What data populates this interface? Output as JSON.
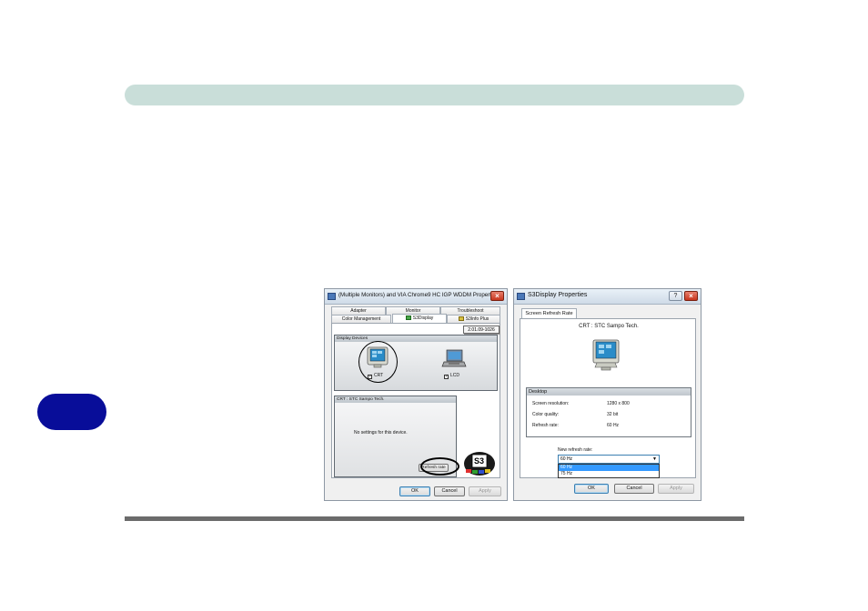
{
  "dialog_left": {
    "title": "(Multiple Monitors) and VIA Chrome9 HC IGP WDDM  Properties",
    "close_symbol": "×",
    "tabs_row1": [
      "Adapter",
      "Monitor",
      "Troubleshoot"
    ],
    "tabs_row2": [
      "Color Management",
      "S3Display",
      "S3Info Plus"
    ],
    "version": "2.01.09-1026",
    "display_devices_label": "Display Devices",
    "crt_label": "CRT",
    "lcd_label": "LCD",
    "device_group_label": "CRT : STC Sampo Tech.",
    "no_settings_text": "No settings for this device.",
    "refresh_rate_button": "Refresh rate",
    "logo_text": "S3",
    "buttons": {
      "ok": "OK",
      "cancel": "Cancel",
      "apply": "Apply"
    }
  },
  "dialog_right": {
    "title": "S3Display Properties",
    "help_symbol": "?",
    "close_symbol": "×",
    "tab": "Screen Refresh Rate",
    "device_name": "CRT : STC Sampo Tech.",
    "desktop_label": "Desktop",
    "rows": [
      {
        "label": "Screen resolution:",
        "value": "1280 x 800"
      },
      {
        "label": "Color quality:",
        "value": "32 bit"
      },
      {
        "label": "Refresh rate:",
        "value": "60 Hz"
      }
    ],
    "new_refresh_label": "New refresh rate:",
    "selected_value": "60 Hz",
    "dropdown_options": [
      "60 Hz",
      "75 Hz"
    ],
    "buttons": {
      "ok": "OK",
      "cancel": "Cancel",
      "apply": "Apply"
    }
  },
  "colors": {
    "header_bar": "#c9ded9",
    "side_tab": "#080d99",
    "footer_line": "#6b6b6b",
    "highlight": "#3399ff"
  }
}
